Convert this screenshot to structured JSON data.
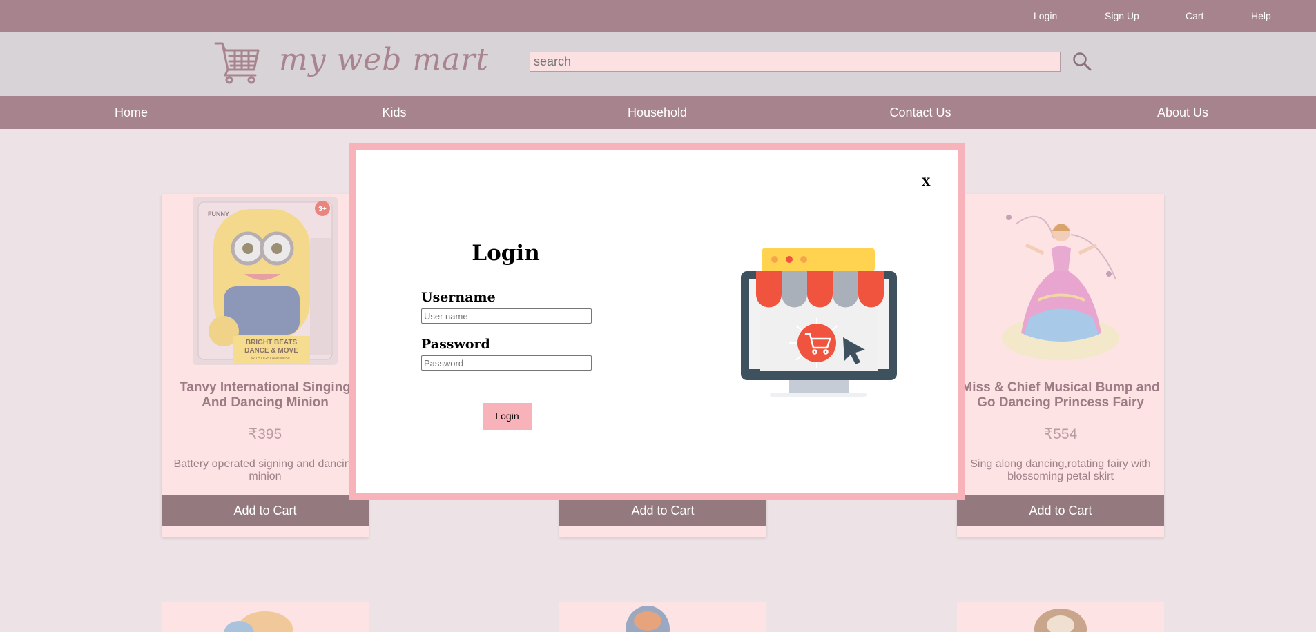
{
  "topbar": {
    "links": [
      {
        "label": "Login"
      },
      {
        "label": "Sign Up"
      },
      {
        "label": "Cart"
      },
      {
        "label": "Help"
      }
    ]
  },
  "header": {
    "logo_text": "my web mart",
    "search_placeholder": "search"
  },
  "nav": {
    "items": [
      {
        "label": "Home"
      },
      {
        "label": "Kids"
      },
      {
        "label": "Household"
      },
      {
        "label": "Contact Us"
      },
      {
        "label": "About Us"
      }
    ]
  },
  "products": [
    {
      "title": "Tanvy International Singing And Dancing Minion",
      "price": "₹395",
      "description": "Battery operated signing and dancing minion",
      "button": "Add to Cart",
      "image_labels": [
        "BRIGHT BEATS",
        "DANCE & MOVE",
        "WITH LIGHT AND MUSIC",
        "FUNNY",
        "3+"
      ]
    },
    {
      "title": "",
      "price": "",
      "description": "",
      "button": "Add to Cart"
    },
    {
      "title": "Miss & Chief Musical Bump and Go Dancing Princess Fairy",
      "price": "₹554",
      "description": "Sing along dancing,rotating fairy with blossoming petal skirt",
      "button": "Add to Cart"
    }
  ],
  "modal": {
    "close_label": "X",
    "title": "Login",
    "username_label": "Username",
    "username_placeholder": "User name",
    "password_label": "Password",
    "password_placeholder": "Password",
    "submit_label": "Login"
  },
  "colors": {
    "bar": "#a6838d",
    "header_bg": "#d8d3d7",
    "page_bg": "#ede2e6",
    "card_bg": "#fde3e4",
    "cart_button": "#947a7f",
    "modal_border": "#f7b3b9",
    "awning_red": "#f0533e",
    "awning_grey": "#a9b0ba",
    "awning_yellow": "#ffd24f",
    "monitor_frame": "#3e515f"
  },
  "icons": {
    "logo": "shopping-cart-icon",
    "search": "magnifier-icon",
    "illustration": "online-shop-icon"
  }
}
